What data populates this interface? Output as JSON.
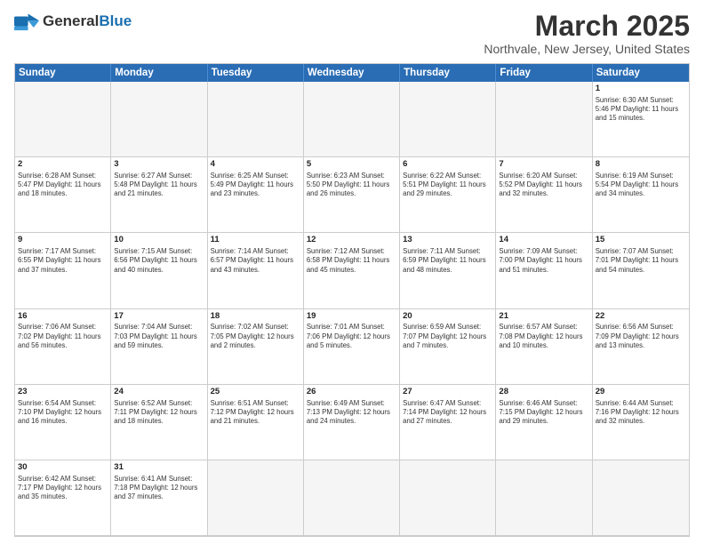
{
  "header": {
    "logo_general": "General",
    "logo_blue": "Blue",
    "month_title": "March 2025",
    "location": "Northvale, New Jersey, United States"
  },
  "days_of_week": [
    "Sunday",
    "Monday",
    "Tuesday",
    "Wednesday",
    "Thursday",
    "Friday",
    "Saturday"
  ],
  "cells": [
    {
      "day": "",
      "info": "",
      "empty": true
    },
    {
      "day": "",
      "info": "",
      "empty": true
    },
    {
      "day": "",
      "info": "",
      "empty": true
    },
    {
      "day": "",
      "info": "",
      "empty": true
    },
    {
      "day": "",
      "info": "",
      "empty": true
    },
    {
      "day": "",
      "info": "",
      "empty": true
    },
    {
      "day": "1",
      "info": "Sunrise: 6:30 AM\nSunset: 5:46 PM\nDaylight: 11 hours\nand 15 minutes."
    },
    {
      "day": "2",
      "info": "Sunrise: 6:28 AM\nSunset: 5:47 PM\nDaylight: 11 hours\nand 18 minutes."
    },
    {
      "day": "3",
      "info": "Sunrise: 6:27 AM\nSunset: 5:48 PM\nDaylight: 11 hours\nand 21 minutes."
    },
    {
      "day": "4",
      "info": "Sunrise: 6:25 AM\nSunset: 5:49 PM\nDaylight: 11 hours\nand 23 minutes."
    },
    {
      "day": "5",
      "info": "Sunrise: 6:23 AM\nSunset: 5:50 PM\nDaylight: 11 hours\nand 26 minutes."
    },
    {
      "day": "6",
      "info": "Sunrise: 6:22 AM\nSunset: 5:51 PM\nDaylight: 11 hours\nand 29 minutes."
    },
    {
      "day": "7",
      "info": "Sunrise: 6:20 AM\nSunset: 5:52 PM\nDaylight: 11 hours\nand 32 minutes."
    },
    {
      "day": "8",
      "info": "Sunrise: 6:19 AM\nSunset: 5:54 PM\nDaylight: 11 hours\nand 34 minutes."
    },
    {
      "day": "9",
      "info": "Sunrise: 7:17 AM\nSunset: 6:55 PM\nDaylight: 11 hours\nand 37 minutes."
    },
    {
      "day": "10",
      "info": "Sunrise: 7:15 AM\nSunset: 6:56 PM\nDaylight: 11 hours\nand 40 minutes."
    },
    {
      "day": "11",
      "info": "Sunrise: 7:14 AM\nSunset: 6:57 PM\nDaylight: 11 hours\nand 43 minutes."
    },
    {
      "day": "12",
      "info": "Sunrise: 7:12 AM\nSunset: 6:58 PM\nDaylight: 11 hours\nand 45 minutes."
    },
    {
      "day": "13",
      "info": "Sunrise: 7:11 AM\nSunset: 6:59 PM\nDaylight: 11 hours\nand 48 minutes."
    },
    {
      "day": "14",
      "info": "Sunrise: 7:09 AM\nSunset: 7:00 PM\nDaylight: 11 hours\nand 51 minutes."
    },
    {
      "day": "15",
      "info": "Sunrise: 7:07 AM\nSunset: 7:01 PM\nDaylight: 11 hours\nand 54 minutes."
    },
    {
      "day": "16",
      "info": "Sunrise: 7:06 AM\nSunset: 7:02 PM\nDaylight: 11 hours\nand 56 minutes."
    },
    {
      "day": "17",
      "info": "Sunrise: 7:04 AM\nSunset: 7:03 PM\nDaylight: 11 hours\nand 59 minutes."
    },
    {
      "day": "18",
      "info": "Sunrise: 7:02 AM\nSunset: 7:05 PM\nDaylight: 12 hours\nand 2 minutes."
    },
    {
      "day": "19",
      "info": "Sunrise: 7:01 AM\nSunset: 7:06 PM\nDaylight: 12 hours\nand 5 minutes."
    },
    {
      "day": "20",
      "info": "Sunrise: 6:59 AM\nSunset: 7:07 PM\nDaylight: 12 hours\nand 7 minutes."
    },
    {
      "day": "21",
      "info": "Sunrise: 6:57 AM\nSunset: 7:08 PM\nDaylight: 12 hours\nand 10 minutes."
    },
    {
      "day": "22",
      "info": "Sunrise: 6:56 AM\nSunset: 7:09 PM\nDaylight: 12 hours\nand 13 minutes."
    },
    {
      "day": "23",
      "info": "Sunrise: 6:54 AM\nSunset: 7:10 PM\nDaylight: 12 hours\nand 16 minutes."
    },
    {
      "day": "24",
      "info": "Sunrise: 6:52 AM\nSunset: 7:11 PM\nDaylight: 12 hours\nand 18 minutes."
    },
    {
      "day": "25",
      "info": "Sunrise: 6:51 AM\nSunset: 7:12 PM\nDaylight: 12 hours\nand 21 minutes."
    },
    {
      "day": "26",
      "info": "Sunrise: 6:49 AM\nSunset: 7:13 PM\nDaylight: 12 hours\nand 24 minutes."
    },
    {
      "day": "27",
      "info": "Sunrise: 6:47 AM\nSunset: 7:14 PM\nDaylight: 12 hours\nand 27 minutes."
    },
    {
      "day": "28",
      "info": "Sunrise: 6:46 AM\nSunset: 7:15 PM\nDaylight: 12 hours\nand 29 minutes."
    },
    {
      "day": "29",
      "info": "Sunrise: 6:44 AM\nSunset: 7:16 PM\nDaylight: 12 hours\nand 32 minutes."
    },
    {
      "day": "30",
      "info": "Sunrise: 6:42 AM\nSunset: 7:17 PM\nDaylight: 12 hours\nand 35 minutes."
    },
    {
      "day": "31",
      "info": "Sunrise: 6:41 AM\nSunset: 7:18 PM\nDaylight: 12 hours\nand 37 minutes."
    },
    {
      "day": "",
      "info": "",
      "empty": true
    },
    {
      "day": "",
      "info": "",
      "empty": true
    },
    {
      "day": "",
      "info": "",
      "empty": true
    },
    {
      "day": "",
      "info": "",
      "empty": true
    },
    {
      "day": "",
      "info": "",
      "empty": true
    }
  ]
}
